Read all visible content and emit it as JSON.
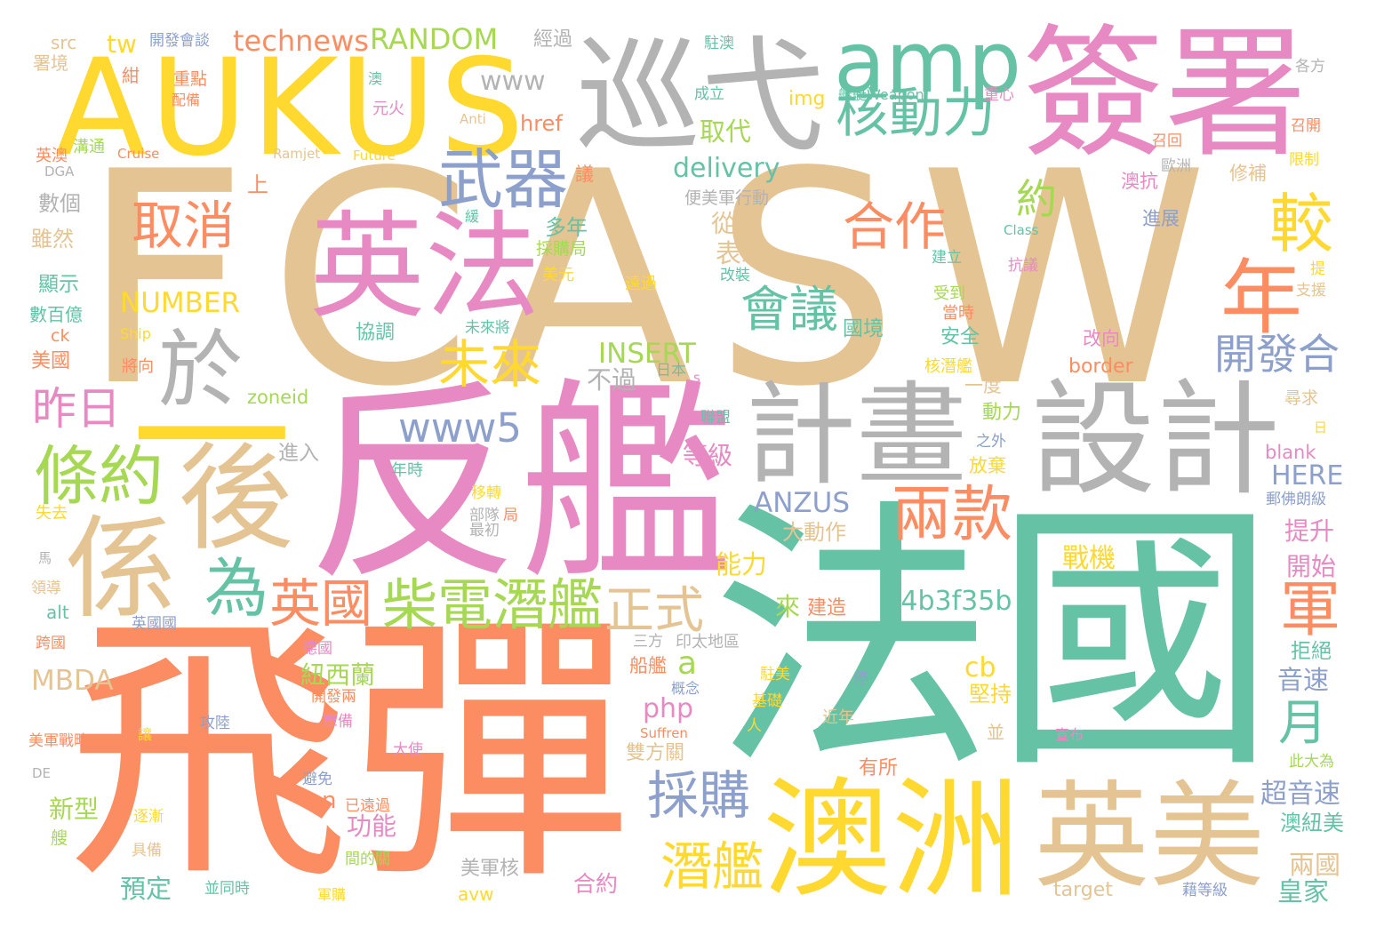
{
  "palette": {
    "orange": "#fc8d62",
    "green": "#66c2a5",
    "blue": "#8da0cb",
    "pink": "#e78ac3",
    "lime": "#a6d854",
    "yellow": "#ffd92f",
    "tan": "#e5c494",
    "gray": "#b3b3b3"
  },
  "words": [
    {
      "text": "FCASW",
      "color": "tan"
    },
    {
      "text": "反艦",
      "color": "pink"
    },
    {
      "text": "飛彈",
      "color": "orange"
    },
    {
      "text": "法國",
      "color": "green"
    },
    {
      "text": "巡弋",
      "color": "gray"
    },
    {
      "text": "簽署",
      "color": "pink"
    },
    {
      "text": "AUKUS",
      "color": "yellow"
    },
    {
      "text": "amp",
      "color": "green"
    },
    {
      "text": "英法",
      "color": "pink"
    },
    {
      "text": "武器",
      "color": "blue"
    },
    {
      "text": "核動力",
      "color": "green"
    },
    {
      "text": "計畫",
      "color": "gray"
    },
    {
      "text": "設計",
      "color": "gray"
    },
    {
      "text": "澳洲",
      "color": "yellow"
    },
    {
      "text": "英美",
      "color": "tan"
    },
    {
      "text": "係",
      "color": "tan"
    },
    {
      "text": "後",
      "color": "tan"
    },
    {
      "text": "一",
      "color": "yellow"
    },
    {
      "text": "於",
      "color": "gray"
    },
    {
      "text": "條約",
      "color": "lime"
    },
    {
      "text": "為",
      "color": "green"
    },
    {
      "text": "英國",
      "color": "orange"
    },
    {
      "text": "柴電潛艦",
      "color": "lime"
    },
    {
      "text": "正式",
      "color": "tan"
    },
    {
      "text": "取消",
      "color": "orange"
    },
    {
      "text": "合作",
      "color": "orange"
    },
    {
      "text": "較",
      "color": "yellow"
    },
    {
      "text": "年",
      "color": "orange"
    },
    {
      "text": "會議",
      "color": "green"
    },
    {
      "text": "未來",
      "color": "yellow"
    },
    {
      "text": "昨日",
      "color": "pink"
    },
    {
      "text": "兩款",
      "color": "orange"
    },
    {
      "text": "開發合",
      "color": "blue"
    },
    {
      "text": "軍",
      "color": "orange"
    },
    {
      "text": "月",
      "color": "green"
    },
    {
      "text": "採購",
      "color": "blue"
    },
    {
      "text": "潛艦",
      "color": "yellow"
    },
    {
      "text": "約",
      "color": "lime"
    },
    {
      "text": "www5",
      "color": "blue"
    },
    {
      "text": "RANDOM",
      "color": "lime"
    },
    {
      "text": "technews",
      "color": "orange"
    },
    {
      "text": "tw",
      "color": "yellow"
    },
    {
      "text": "src",
      "color": "tan"
    },
    {
      "text": "開發會談",
      "color": "blue"
    },
    {
      "text": "經過",
      "color": "gray"
    },
    {
      "text": "駐澳",
      "color": "green"
    },
    {
      "text": "署境",
      "color": "tan"
    },
    {
      "text": "紺",
      "color": "orange"
    },
    {
      "text": "重點",
      "color": "orange"
    },
    {
      "text": "配備",
      "color": "orange"
    },
    {
      "text": "澳",
      "color": "green"
    },
    {
      "text": "元火",
      "color": "pink"
    },
    {
      "text": "www",
      "color": "gray"
    },
    {
      "text": "Anti",
      "color": "tan"
    },
    {
      "text": "href",
      "color": "orange"
    },
    {
      "text": "成立",
      "color": "green"
    },
    {
      "text": "img",
      "color": "yellow"
    },
    {
      "text": "艦艇Weapon",
      "color": "green"
    },
    {
      "text": "重心",
      "color": "pink"
    },
    {
      "text": "各方",
      "color": "gray"
    },
    {
      "text": "召開",
      "color": "orange"
    },
    {
      "text": "召回",
      "color": "orange"
    },
    {
      "text": "限制",
      "color": "yellow"
    },
    {
      "text": "歐洲",
      "color": "gray"
    },
    {
      "text": "修補",
      "color": "tan"
    },
    {
      "text": "澳抗",
      "color": "pink"
    },
    {
      "text": "進展",
      "color": "blue"
    },
    {
      "text": "Class",
      "color": "green"
    },
    {
      "text": "建立",
      "color": "green"
    },
    {
      "text": "抗議",
      "color": "pink"
    },
    {
      "text": "提",
      "color": "yellow"
    },
    {
      "text": "支援",
      "color": "tan"
    },
    {
      "text": "受到",
      "color": "lime"
    },
    {
      "text": "當時",
      "color": "orange"
    },
    {
      "text": "安全",
      "color": "green"
    },
    {
      "text": "核潛艦",
      "color": "yellow"
    },
    {
      "text": "一度",
      "color": "tan"
    },
    {
      "text": "動力",
      "color": "lime"
    },
    {
      "text": "之外",
      "color": "blue"
    },
    {
      "text": "放棄",
      "color": "yellow"
    },
    {
      "text": "改向",
      "color": "pink"
    },
    {
      "text": "border",
      "color": "orange"
    },
    {
      "text": "尋求",
      "color": "tan"
    },
    {
      "text": "日",
      "color": "yellow"
    },
    {
      "text": "blank",
      "color": "pink"
    },
    {
      "text": "HERE",
      "color": "blue"
    },
    {
      "text": "郵佛朗級",
      "color": "blue"
    },
    {
      "text": "提升",
      "color": "pink"
    },
    {
      "text": "開始",
      "color": "pink"
    },
    {
      "text": "戰機",
      "color": "yellow"
    },
    {
      "text": "拒絕",
      "color": "green"
    },
    {
      "text": "音速",
      "color": "blue"
    },
    {
      "text": "此大為",
      "color": "lime"
    },
    {
      "text": "超音速",
      "color": "blue"
    },
    {
      "text": "澳紐美",
      "color": "green"
    },
    {
      "text": "兩國",
      "color": "tan"
    },
    {
      "text": "皇家",
      "color": "green"
    },
    {
      "text": "target",
      "color": "tan"
    },
    {
      "text": "藉等級",
      "color": "blue"
    },
    {
      "text": "宣布",
      "color": "pink"
    },
    {
      "text": "並",
      "color": "tan"
    },
    {
      "text": "cb",
      "color": "yellow"
    },
    {
      "text": "堅持",
      "color": "yellow"
    },
    {
      "text": "有所",
      "color": "orange"
    },
    {
      "text": "近年",
      "color": "tan"
    },
    {
      "text": "停",
      "color": "blue"
    },
    {
      "text": "駐美",
      "color": "yellow"
    },
    {
      "text": "基礎",
      "color": "yellow"
    },
    {
      "text": "人",
      "color": "yellow"
    },
    {
      "text": "概念",
      "color": "blue"
    },
    {
      "text": "php",
      "color": "pink"
    },
    {
      "text": "Suffren",
      "color": "orange"
    },
    {
      "text": "雙方關",
      "color": "tan"
    },
    {
      "text": "a",
      "color": "lime"
    },
    {
      "text": "船艦",
      "color": "orange"
    },
    {
      "text": "三方",
      "color": "gray"
    },
    {
      "text": "印太地區",
      "color": "gray"
    },
    {
      "text": "來",
      "color": "lime"
    },
    {
      "text": "建造",
      "color": "orange"
    },
    {
      "text": "a4b3f35b",
      "color": "green"
    },
    {
      "text": "能力",
      "color": "yellow"
    },
    {
      "text": "大動作",
      "color": "tan"
    },
    {
      "text": "ANZUS",
      "color": "blue"
    },
    {
      "text": "等級",
      "color": "pink"
    },
    {
      "text": "聯盟",
      "color": "green"
    },
    {
      "text": "不過",
      "color": "gray"
    },
    {
      "text": "日本",
      "color": "green"
    },
    {
      "text": "s",
      "color": "pink"
    },
    {
      "text": "INSERT",
      "color": "lime"
    },
    {
      "text": "國境",
      "color": "green"
    },
    {
      "text": "改裝",
      "color": "green"
    },
    {
      "text": "遠過",
      "color": "yellow"
    },
    {
      "text": "表示",
      "color": "tan"
    },
    {
      "text": "從",
      "color": "tan"
    },
    {
      "text": "便美軍行動",
      "color": "gray"
    },
    {
      "text": "delivery",
      "color": "green"
    },
    {
      "text": "取代",
      "color": "lime"
    },
    {
      "text": "議",
      "color": "orange"
    },
    {
      "text": "多年",
      "color": "green"
    },
    {
      "text": "採購局",
      "color": "lime"
    },
    {
      "text": "美元",
      "color": "yellow"
    },
    {
      "text": "緩",
      "color": "green"
    },
    {
      "text": "未來將",
      "color": "green"
    },
    {
      "text": "協調",
      "color": "green"
    },
    {
      "text": "年時",
      "color": "green"
    },
    {
      "text": "移轉",
      "color": "yellow"
    },
    {
      "text": "部隊",
      "color": "gray"
    },
    {
      "text": "局",
      "color": "orange"
    },
    {
      "text": "最初",
      "color": "gray"
    },
    {
      "text": "進入",
      "color": "gray"
    },
    {
      "text": "zoneid",
      "color": "lime"
    },
    {
      "text": "NUMBER",
      "color": "yellow"
    },
    {
      "text": "Ship",
      "color": "yellow"
    },
    {
      "text": "將向",
      "color": "orange"
    },
    {
      "text": "顯示",
      "color": "green"
    },
    {
      "text": "數百億",
      "color": "green"
    },
    {
      "text": "ck",
      "color": "orange"
    },
    {
      "text": "美國",
      "color": "orange"
    },
    {
      "text": "上",
      "color": "orange"
    },
    {
      "text": "數個",
      "color": "gray"
    },
    {
      "text": "雖然",
      "color": "tan"
    },
    {
      "text": "DGA",
      "color": "gray"
    },
    {
      "text": "英澳",
      "color": "orange"
    },
    {
      "text": "溝通",
      "color": "lime"
    },
    {
      "text": "Cruise",
      "color": "orange"
    },
    {
      "text": "Ramjet",
      "color": "tan"
    },
    {
      "text": "Future",
      "color": "yellow"
    },
    {
      "text": "失去",
      "color": "yellow"
    },
    {
      "text": "馬",
      "color": "gray"
    },
    {
      "text": "領導",
      "color": "tan"
    },
    {
      "text": "alt",
      "color": "green"
    },
    {
      "text": "英國國",
      "color": "blue"
    },
    {
      "text": "跨國",
      "color": "orange"
    },
    {
      "text": "MBDA",
      "color": "tan"
    },
    {
      "text": "美軍戰略",
      "color": "orange"
    },
    {
      "text": "DE",
      "color": "gray"
    },
    {
      "text": "新型",
      "color": "lime"
    },
    {
      "text": "艘",
      "color": "lime"
    },
    {
      "text": "逐漸",
      "color": "yellow"
    },
    {
      "text": "具備",
      "color": "tan"
    },
    {
      "text": "預定",
      "color": "green"
    },
    {
      "text": "並同時",
      "color": "green"
    },
    {
      "text": "軍購",
      "color": "yellow"
    },
    {
      "text": "攻陸",
      "color": "blue"
    },
    {
      "text": "讓",
      "color": "yellow"
    },
    {
      "text": "德國",
      "color": "pink"
    },
    {
      "text": "紐西蘭",
      "color": "lime"
    },
    {
      "text": "開發兩",
      "color": "orange"
    },
    {
      "text": "軍備",
      "color": "pink"
    },
    {
      "text": "大使",
      "color": "pink"
    },
    {
      "text": "避免",
      "color": "blue"
    },
    {
      "text": "n",
      "color": "orange"
    },
    {
      "text": "已遠過",
      "color": "orange"
    },
    {
      "text": "功能",
      "color": "pink"
    },
    {
      "text": "間的關",
      "color": "lime"
    },
    {
      "text": "美軍核",
      "color": "gray"
    },
    {
      "text": "avw",
      "color": "yellow"
    },
    {
      "text": "合約",
      "color": "pink"
    }
  ]
}
